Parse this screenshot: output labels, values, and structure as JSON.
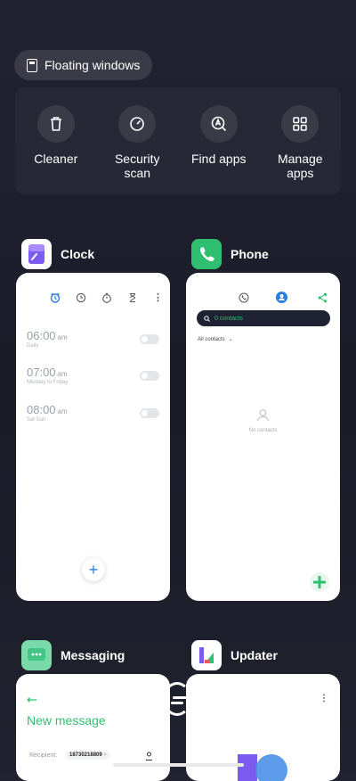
{
  "floating_windows": {
    "label": "Floating windows"
  },
  "quick_actions": [
    {
      "label": "Cleaner",
      "icon": "trash-icon"
    },
    {
      "label": "Security scan",
      "icon": "gauge-icon"
    },
    {
      "label": "Find apps",
      "icon": "find-apps-icon"
    },
    {
      "label": "Manage apps",
      "icon": "grid-icon"
    }
  ],
  "clock": {
    "title": "Clock",
    "alarms": [
      {
        "time": "06:00",
        "ampm": "am",
        "days": "Daily"
      },
      {
        "time": "07:00",
        "ampm": "am",
        "days": "Monday to Friday"
      },
      {
        "time": "08:00",
        "ampm": "am",
        "days": "Sat Sun"
      }
    ],
    "add_label": "+"
  },
  "phone": {
    "title": "Phone",
    "search_text": "0 contacts",
    "filter_label": "All contacts",
    "empty_label": "No contacts"
  },
  "messaging": {
    "title": "Messaging",
    "new_message": "New message",
    "recipient_label": "Recipient:",
    "recipient_value": "18730218809"
  },
  "updater": {
    "title": "Updater"
  },
  "colors": {
    "accent": "#2a7de1",
    "phone_green": "#2fbf71",
    "bg": "#1d1e2a"
  }
}
